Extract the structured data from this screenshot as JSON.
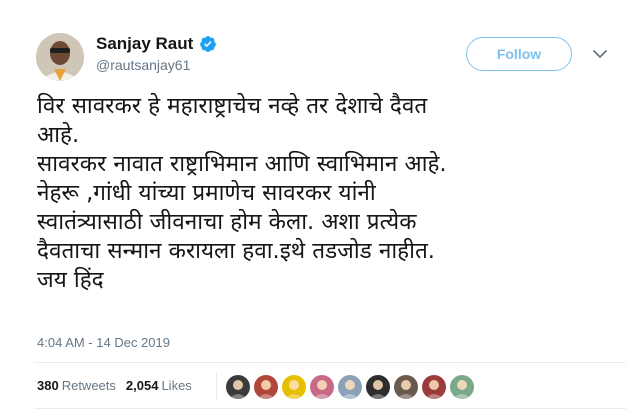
{
  "user": {
    "name": "Sanjay Raut",
    "handle": "@rautsanjay61",
    "verified": true
  },
  "follow_label": "Follow",
  "tweet": {
    "lines": [
      "विर सावरकर हे महाराष्ट्राचेच नव्हे तर देशाचे दैवत",
      "आहे.",
      "सावरकर नावात राष्ट्राभिमान आणि स्वाभिमान आहे.",
      "नेहरू  ,गांधी  यांच्या प्रमाणेच सावरकर यांनी",
      "स्वातंत्र्यासाठी जीवनाचा होम केला. अशा प्रत्येक",
      "दैवताचा सन्मान करायला हवा.इथे तडजोड नाहीत.",
      "जय हिंद"
    ],
    "timestamp": "4:04 AM - 14 Dec 2019"
  },
  "stats": {
    "retweets_count": "380",
    "retweets_label": "Retweets",
    "likes_count": "2,054",
    "likes_label": "Likes"
  },
  "liker_avatars": [
    {
      "color": "#3b3b3b"
    },
    {
      "color": "#b0463a"
    },
    {
      "color": "#e6c000"
    },
    {
      "color": "#c66a88"
    },
    {
      "color": "#8aa1b8"
    },
    {
      "color": "#2d2d2d"
    },
    {
      "color": "#6b5a4e"
    },
    {
      "color": "#9c3b3b"
    },
    {
      "color": "#7ba889"
    }
  ],
  "colors": {
    "accent": "#1da1f2",
    "follow_border": "#7fc1ee",
    "secondary_text": "#657786"
  }
}
